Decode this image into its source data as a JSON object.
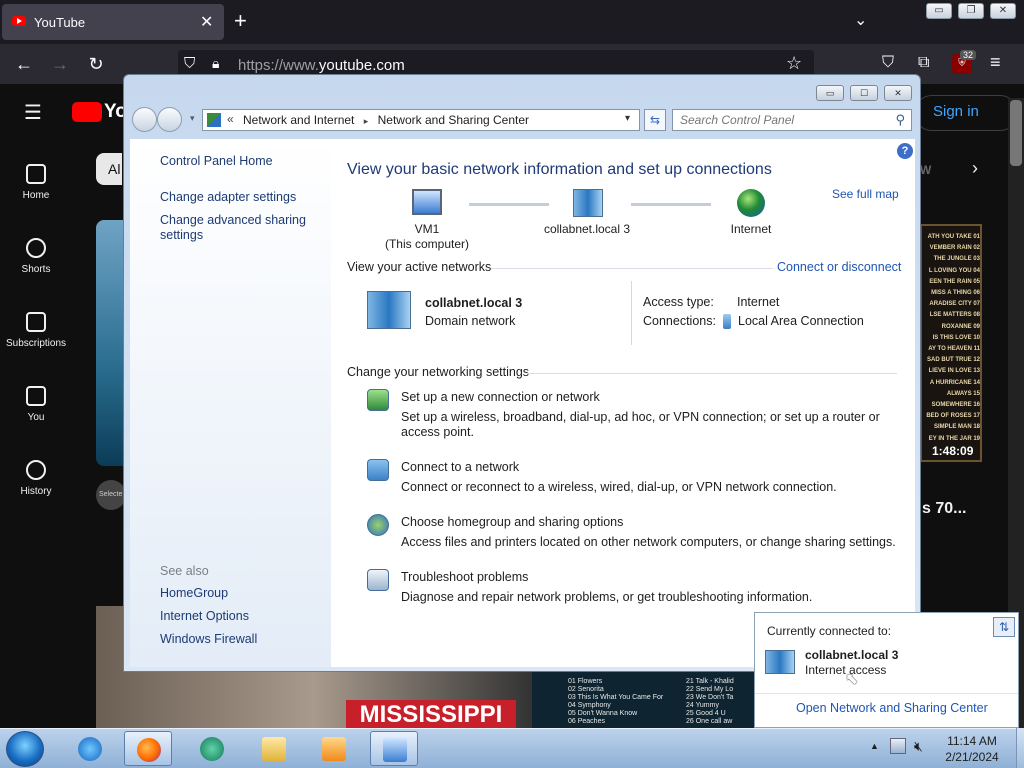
{
  "browser": {
    "tab_title": "YouTube",
    "tab_close": "✕",
    "new_tab": "+",
    "url_prefix": "https://www.",
    "url_rest": "youtube.com",
    "extension_badge": "32"
  },
  "youtube": {
    "logo_text": "Yo",
    "nav": [
      {
        "label": "Home",
        "icon": "home-icon"
      },
      {
        "label": "Shorts",
        "icon": "shorts-icon"
      },
      {
        "label": "Subscriptions",
        "icon": "subscriptions-icon"
      },
      {
        "label": "You",
        "icon": "you-icon"
      },
      {
        "label": "History",
        "icon": "history-icon"
      }
    ],
    "sign_in": "Sign in",
    "chip": "Al",
    "chip_right": "W",
    "thumb_duration": "1:48:09",
    "thumb_title": "s 70...",
    "thumb_banner": "MISSISSIPPI",
    "select_label": "Selecte",
    "playlist": [
      "01 Flowers",
      "02 Senorita",
      "03 This Is What You Came For",
      "04 Symphony",
      "05 Don't Wanna Know",
      "06 Peaches"
    ],
    "playlist2": [
      "21 Talk - Khalid",
      "22 Send My Lo",
      "23 We Don't Ta",
      "24 Yummy",
      "25 Good 4 U",
      "26 One call aw"
    ],
    "tracklist": [
      "ATH YOU TAKE 01",
      "VEMBER RAIN 02",
      "THE JUNGLE 03",
      "L LOVING YOU 04",
      "EEN THE RAIN 05",
      "MISS A THING 06",
      "ARADISE CITY 07",
      "LSE MATTERS 08",
      "ROXANNE 09",
      "IS THIS LOVE 10",
      "AY TO HEAVEN 11",
      "SAD BUT TRUE 12",
      "LIEVE IN LOVE 13",
      "A HURRICANE 14",
      "ALWAYS 15",
      "SOMEWHERE 16",
      "BED OF ROSES 17",
      "SIMPLE MAN 18",
      "EY IN THE JAR 19"
    ]
  },
  "control_panel": {
    "breadcrumb": [
      "«",
      "Network and Internet",
      "Network and Sharing Center"
    ],
    "search_placeholder": "Search Control Panel",
    "sidebar": {
      "home": "Control Panel Home",
      "links": [
        "Change adapter settings",
        "Change advanced sharing settings"
      ],
      "see_also": "See also",
      "see_also_links": [
        "HomeGroup",
        "Internet Options",
        "Windows Firewall"
      ]
    },
    "title": "View your basic network information and set up connections",
    "see_full_map": "See full map",
    "map": {
      "computer": "VM1",
      "computer_sub": "(This computer)",
      "network": "collabnet.local  3",
      "internet": "Internet"
    },
    "active_header": "View your active networks",
    "connect_disconnect": "Connect or disconnect",
    "active": {
      "name": "collabnet.local  3",
      "type": "Domain network",
      "access_label": "Access type:",
      "access_value": "Internet",
      "conn_label": "Connections:",
      "conn_value": "Local Area Connection"
    },
    "change_header": "Change your networking settings",
    "tasks": [
      {
        "title": "Set up a new connection or network",
        "desc": "Set up a wireless, broadband, dial-up, ad hoc, or VPN connection; or set up a router or access point."
      },
      {
        "title": "Connect to a network",
        "desc": "Connect or reconnect to a wireless, wired, dial-up, or VPN network connection."
      },
      {
        "title": "Choose homegroup and sharing options",
        "desc": "Access files and printers located on other network computers, or change sharing settings."
      },
      {
        "title": "Troubleshoot problems",
        "desc": "Diagnose and repair network problems, or get troubleshooting information."
      }
    ]
  },
  "popup": {
    "title": "Currently connected to:",
    "network": "collabnet.local  3",
    "status": "Internet access",
    "link": "Open Network and Sharing Center"
  },
  "taskbar": {
    "time": "11:14 AM",
    "date": "2/21/2024"
  }
}
